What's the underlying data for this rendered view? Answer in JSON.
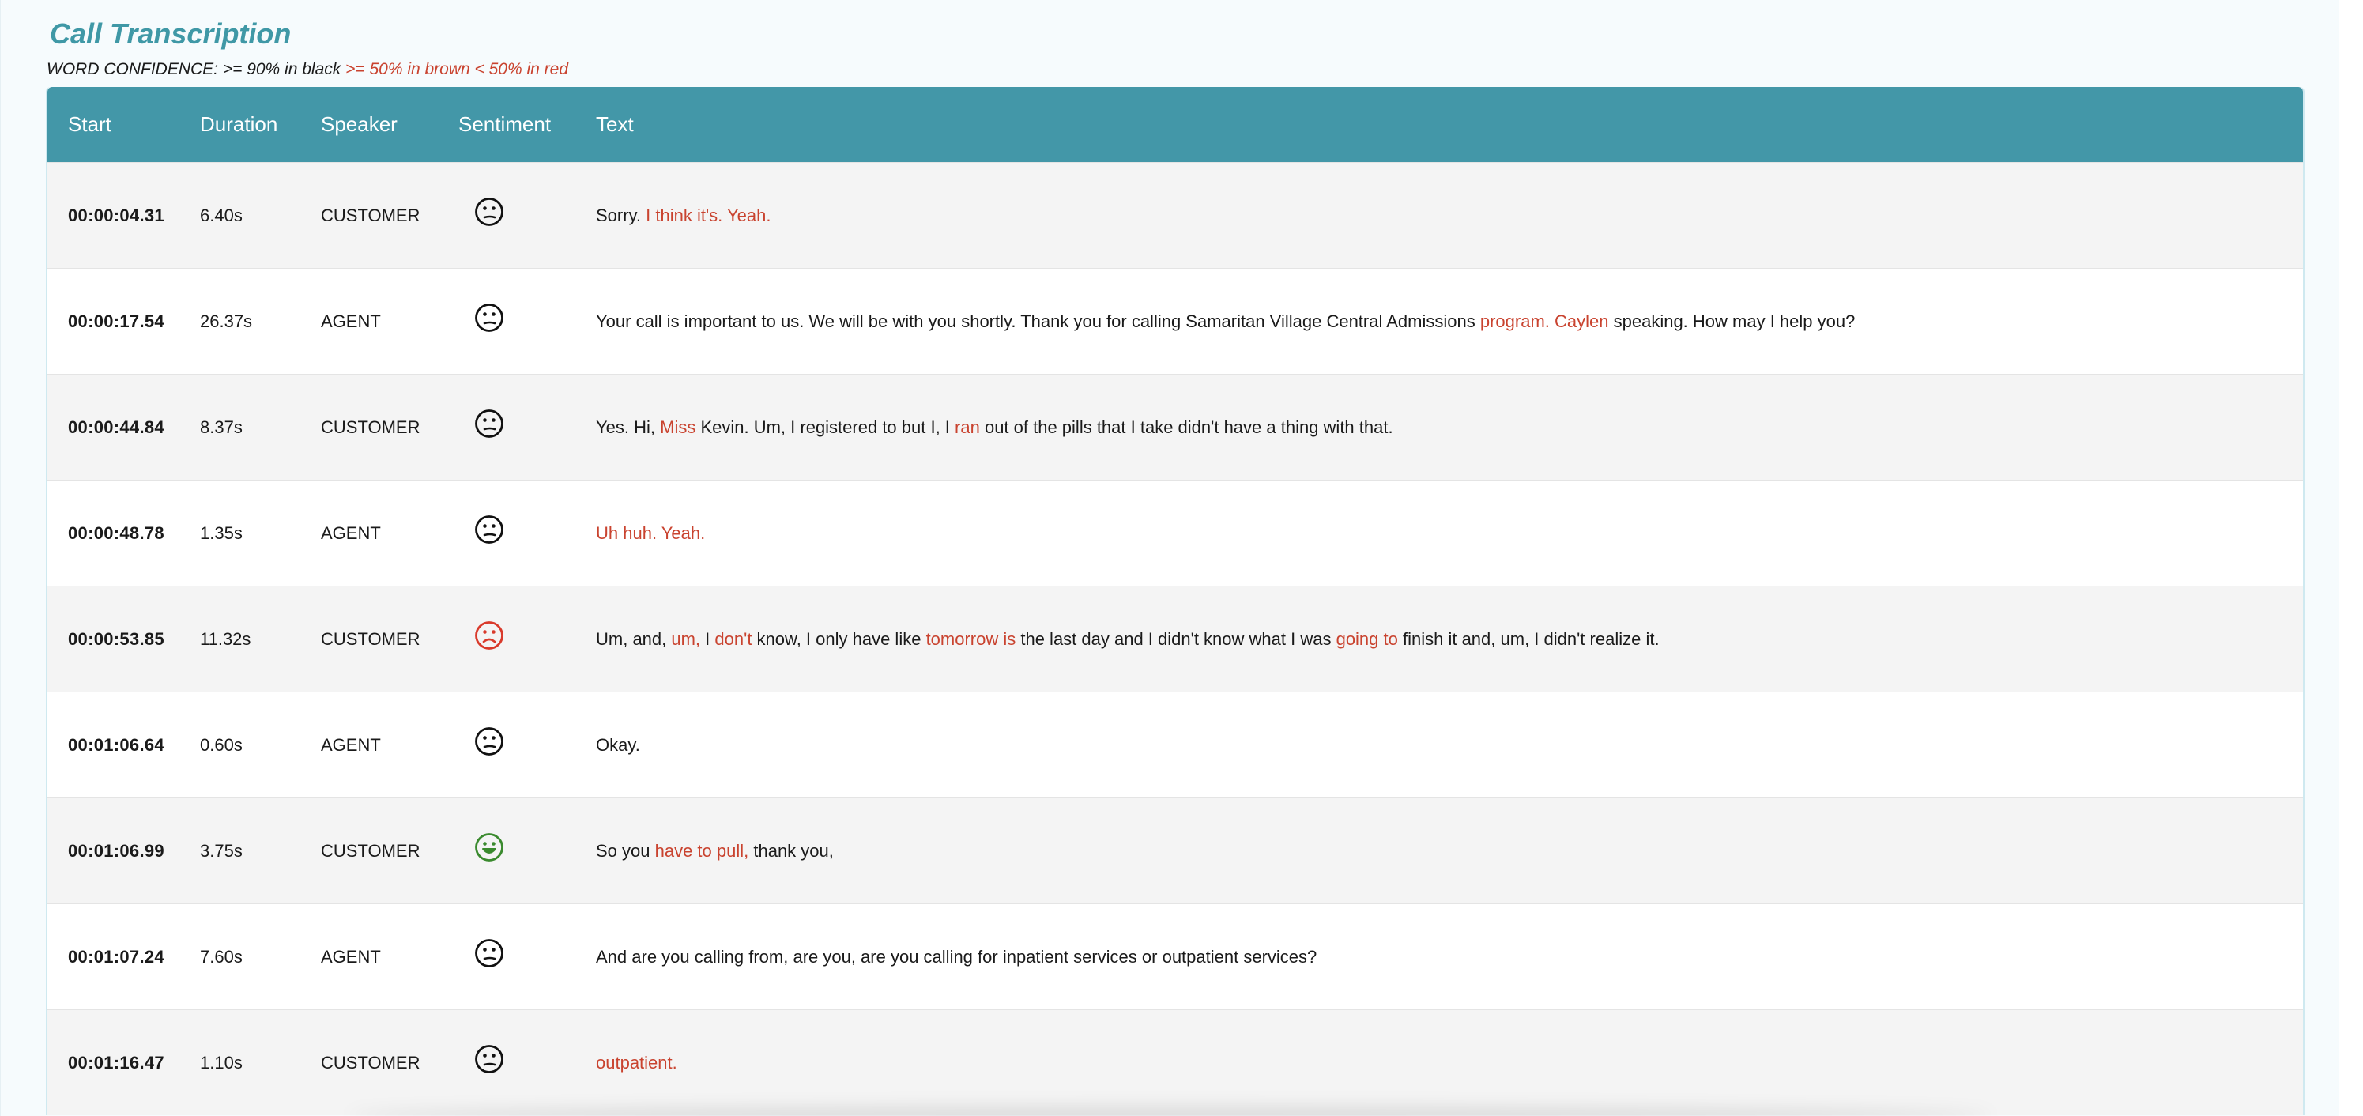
{
  "title": "Call Transcription",
  "legend": {
    "prefix": "WORD CONFIDENCE: >= 90% in black ",
    "low": ">= 50% in brown < 50% in red"
  },
  "colors": {
    "accent": "#4397a8",
    "title": "#3f98a6",
    "low_confidence": "#c9432f",
    "neutral_face": "#111111",
    "negative_face": "#d93a2b",
    "positive_face": "#3a8a2e"
  },
  "columns": [
    "Start",
    "Duration",
    "Speaker",
    "Sentiment",
    "Text"
  ],
  "rows": [
    {
      "start": "00:00:04.31",
      "duration": "6.40s",
      "speaker": "CUSTOMER",
      "sentiment": "neutral",
      "segments": [
        {
          "t": "Sorry. ",
          "c": "high"
        },
        {
          "t": "I think it's. Yeah.",
          "c": "low"
        }
      ]
    },
    {
      "start": "00:00:17.54",
      "duration": "26.37s",
      "speaker": "AGENT",
      "sentiment": "neutral",
      "segments": [
        {
          "t": "Your call is important to us. We will be with you shortly. Thank you for calling Samaritan Village Central Admissions ",
          "c": "high"
        },
        {
          "t": "program. Caylen",
          "c": "low"
        },
        {
          "t": " speaking. How may I help you?",
          "c": "high"
        }
      ]
    },
    {
      "start": "00:00:44.84",
      "duration": "8.37s",
      "speaker": "CUSTOMER",
      "sentiment": "neutral",
      "segments": [
        {
          "t": "Yes. Hi, ",
          "c": "high"
        },
        {
          "t": "Miss",
          "c": "low"
        },
        {
          "t": " Kevin. Um, I registered to but I, I ",
          "c": "high"
        },
        {
          "t": "ran",
          "c": "low"
        },
        {
          "t": " out of the pills that I take didn't have a thing with that.",
          "c": "high"
        }
      ]
    },
    {
      "start": "00:00:48.78",
      "duration": "1.35s",
      "speaker": "AGENT",
      "sentiment": "neutral",
      "segments": [
        {
          "t": "Uh huh. Yeah.",
          "c": "low"
        }
      ]
    },
    {
      "start": "00:00:53.85",
      "duration": "11.32s",
      "speaker": "CUSTOMER",
      "sentiment": "negative",
      "segments": [
        {
          "t": "Um, and, ",
          "c": "high"
        },
        {
          "t": "um,",
          "c": "low"
        },
        {
          "t": " I ",
          "c": "high"
        },
        {
          "t": "don't",
          "c": "low"
        },
        {
          "t": " know, I only have like ",
          "c": "high"
        },
        {
          "t": "tomorrow is",
          "c": "low"
        },
        {
          "t": " the last day and I didn't know what I was ",
          "c": "high"
        },
        {
          "t": "going to",
          "c": "low"
        },
        {
          "t": " finish it and, um, I didn't realize it.",
          "c": "high"
        }
      ]
    },
    {
      "start": "00:01:06.64",
      "duration": "0.60s",
      "speaker": "AGENT",
      "sentiment": "neutral",
      "segments": [
        {
          "t": "Okay.",
          "c": "high"
        }
      ]
    },
    {
      "start": "00:01:06.99",
      "duration": "3.75s",
      "speaker": "CUSTOMER",
      "sentiment": "positive",
      "segments": [
        {
          "t": "So you ",
          "c": "high"
        },
        {
          "t": "have to pull,",
          "c": "low"
        },
        {
          "t": " thank you,",
          "c": "high"
        }
      ]
    },
    {
      "start": "00:01:07.24",
      "duration": "7.60s",
      "speaker": "AGENT",
      "sentiment": "neutral",
      "segments": [
        {
          "t": "And are you calling from, are you, are you calling for inpatient services or outpatient services?",
          "c": "high"
        }
      ]
    },
    {
      "start": "00:01:16.47",
      "duration": "1.10s",
      "speaker": "CUSTOMER",
      "sentiment": "neutral",
      "segments": [
        {
          "t": "outpatient.",
          "c": "low"
        }
      ]
    }
  ]
}
